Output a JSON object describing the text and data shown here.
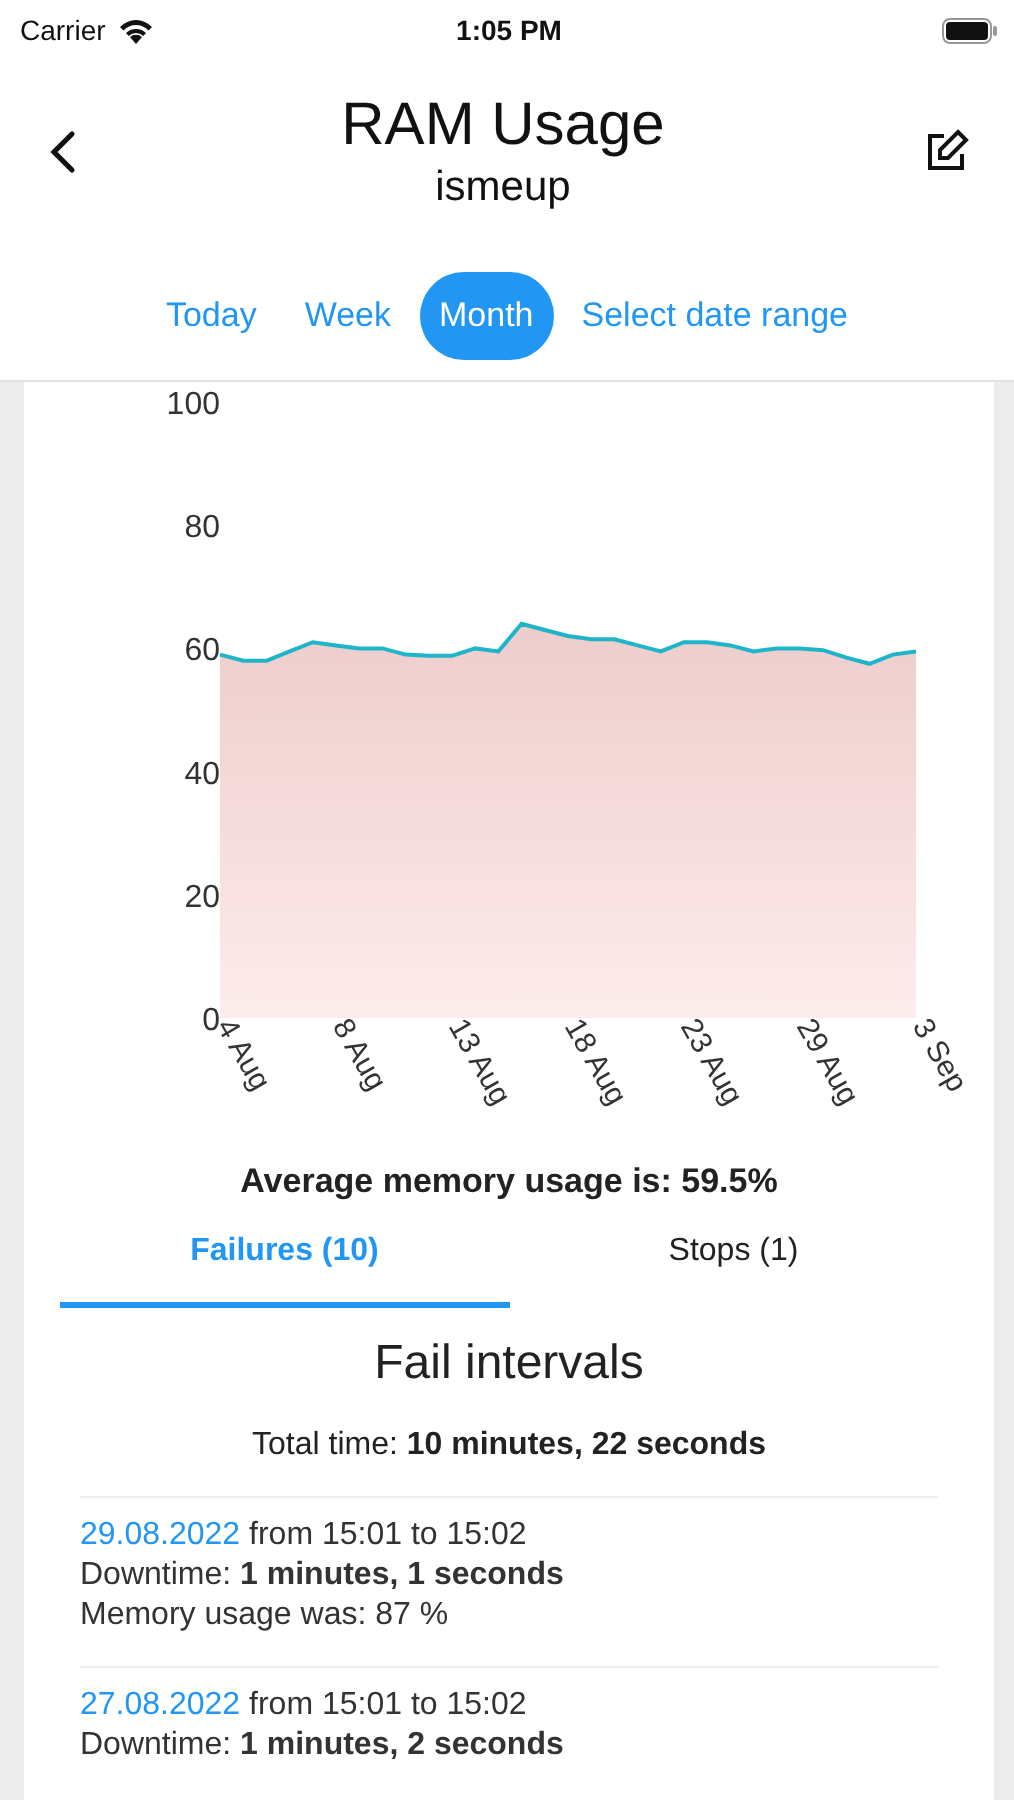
{
  "status_bar": {
    "carrier": "Carrier",
    "time": "1:05 PM"
  },
  "header": {
    "title": "RAM Usage",
    "subtitle": "ismeup"
  },
  "range_tabs": [
    {
      "label": "Today",
      "selected": false
    },
    {
      "label": "Week",
      "selected": false
    },
    {
      "label": "Month",
      "selected": true
    },
    {
      "label": "Select date range",
      "selected": false
    }
  ],
  "chart_data": {
    "type": "area",
    "categories": [
      "4 Aug",
      null,
      null,
      null,
      null,
      "8 Aug",
      null,
      null,
      null,
      null,
      "13 Aug",
      null,
      null,
      null,
      null,
      "18 Aug",
      null,
      null,
      null,
      null,
      "23 Aug",
      null,
      null,
      null,
      null,
      "29 Aug",
      null,
      null,
      null,
      null,
      "3 Sep"
    ],
    "series": [
      {
        "color": "#1fb5c9",
        "values": [
          59,
          58,
          58,
          59.5,
          61,
          60.5,
          60,
          60,
          59,
          58.8,
          58.8,
          60,
          59.5,
          64,
          63,
          62,
          61.5,
          61.5,
          60.5,
          59.5,
          61,
          61,
          60.5,
          59.5,
          60,
          60,
          59.7,
          58.5,
          57.5,
          59,
          59.5
        ]
      }
    ],
    "ylim": [
      0,
      100
    ],
    "yticks": [
      0,
      20,
      40,
      60,
      80,
      100
    ]
  },
  "average": "Average memory usage is: 59.5%",
  "event_tabs": [
    {
      "label": "Failures (10)",
      "selected": true
    },
    {
      "label": "Stops (1)",
      "selected": false
    }
  ],
  "section_title": "Fail intervals",
  "total_time": "Total time: **10 minutes, 22 seconds**",
  "intervals": [
    {
      "date": "29.08.2022",
      "range": "from 15:01 to 15:02",
      "downtime": "Downtime: **1 minutes, 1 seconds**",
      "memory": "Memory usage was: 87 %"
    },
    {
      "date": "27.08.2022",
      "range": "from 15:01 to 15:02",
      "downtime": "Downtime: **1 minutes, 2 seconds**"
    }
  ]
}
